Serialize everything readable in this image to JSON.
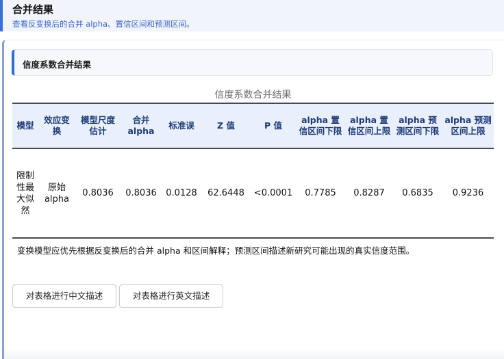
{
  "page": {
    "title": "合并结果",
    "subtitle": "查看反变换后的合并 alpha、置信区间和预测区间。"
  },
  "section": {
    "title": "信度系数合并结果"
  },
  "table": {
    "caption": "信度系数合并结果",
    "headers": [
      "模型",
      "效应变换",
      "模型尺度估计",
      "合并 alpha",
      "标准误",
      "Z 值",
      "P 值",
      "alpha 置信区间下限",
      "alpha 置信区间上限",
      "alpha 预测区间下限",
      "alpha 预测区间上限"
    ],
    "rows": [
      [
        "限制性最大似然",
        "原始 alpha",
        "0.8036",
        "0.8036",
        "0.0128",
        "62.6448",
        "<0.0001",
        "0.7785",
        "0.8287",
        "0.6835",
        "0.9236"
      ]
    ]
  },
  "note": "变换模型应优先根据反变换后的合并 alpha 和区间解释；预测区间描述新研究可能出现的真实信度范围。",
  "buttons": {
    "describe_zh": "对表格进行中文描述",
    "describe_en": "对表格进行英文描述"
  }
}
